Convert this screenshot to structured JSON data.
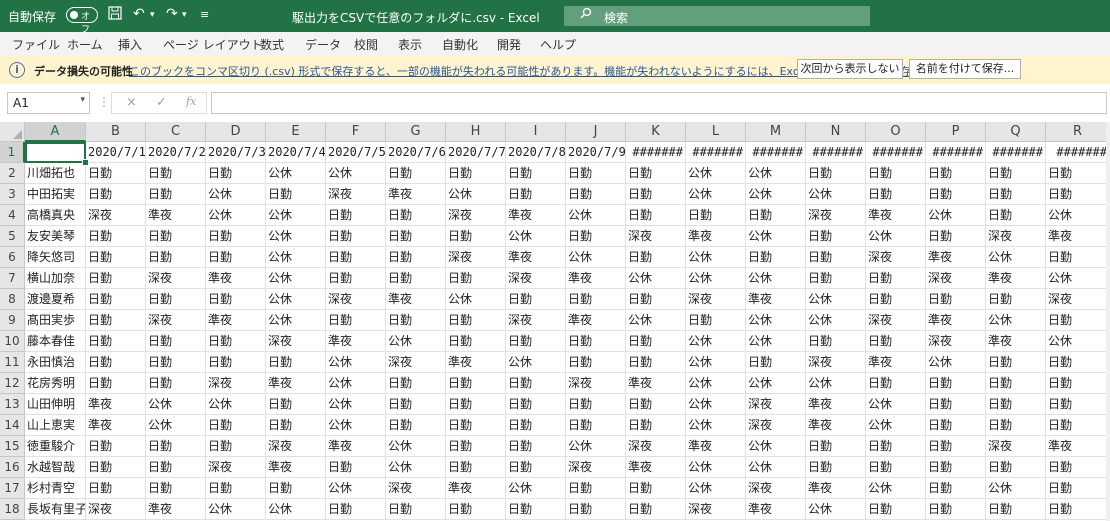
{
  "title_bar": {
    "autosave_label": "自動保存",
    "autosave_state": "オフ",
    "save_icon": "save-icon",
    "undo_icon": "undo-icon",
    "redo_icon": "redo-icon",
    "qat_icon": "customize-icon",
    "doc_title": "駆出力をCSVで任意のフォルダに.csv  -  Excel",
    "search_placeholder": "検索"
  },
  "menu": [
    "ファイル",
    "ホーム",
    "挿入",
    "ページ レイアウト",
    "数式",
    "データ",
    "校閲",
    "表示",
    "自動化",
    "開発",
    "ヘルプ"
  ],
  "infobar": {
    "title": "データ損失の可能性",
    "message": "このブックをコンマ区切り (.csv) 形式で保存すると、一部の機能が失われる可能性があります。機能が失われないようにするには、Excel ファイル形式で保存してください。",
    "btn_dismiss": "次回から表示しない",
    "btn_saveas": "名前を付けて保存..."
  },
  "formula_bar": {
    "name_box": "A1",
    "fx": "fx",
    "cancel": "×",
    "enter": "✓",
    "dots": "⋮",
    "dropdown": "▾",
    "value": ""
  },
  "columns": [
    "A",
    "B",
    "C",
    "D",
    "E",
    "F",
    "G",
    "H",
    "I",
    "J",
    "K",
    "L",
    "M",
    "N",
    "O",
    "P",
    "Q",
    "R"
  ],
  "row_numbers": [
    "1",
    "2",
    "3",
    "4",
    "5",
    "6",
    "7",
    "8",
    "9",
    "10",
    "11",
    "12",
    "13",
    "14",
    "15",
    "16",
    "17",
    "18"
  ],
  "rows": [
    [
      "",
      "2020/7/1",
      "2020/7/2",
      "2020/7/3",
      "2020/7/4",
      "2020/7/5",
      "2020/7/6",
      "2020/7/7",
      "2020/7/8",
      "2020/7/9",
      "#######",
      "#######",
      "#######",
      "#######",
      "#######",
      "#######",
      "#######",
      "#######"
    ],
    [
      "川畑拓也",
      "日勤",
      "日勤",
      "日勤",
      "公休",
      "公休",
      "日勤",
      "日勤",
      "日勤",
      "日勤",
      "日勤",
      "公休",
      "公休",
      "日勤",
      "日勤",
      "日勤",
      "日勤",
      "日勤"
    ],
    [
      "中田拓実",
      "日勤",
      "日勤",
      "公休",
      "日勤",
      "深夜",
      "準夜",
      "公休",
      "日勤",
      "日勤",
      "日勤",
      "公休",
      "公休",
      "公休",
      "日勤",
      "日勤",
      "日勤",
      "日勤"
    ],
    [
      "高橋真央",
      "深夜",
      "準夜",
      "公休",
      "公休",
      "日勤",
      "日勤",
      "深夜",
      "準夜",
      "公休",
      "日勤",
      "日勤",
      "日勤",
      "深夜",
      "準夜",
      "公休",
      "日勤",
      "公休"
    ],
    [
      "友安美琴",
      "日勤",
      "日勤",
      "日勤",
      "公休",
      "日勤",
      "日勤",
      "日勤",
      "公休",
      "日勤",
      "深夜",
      "準夜",
      "公休",
      "日勤",
      "公休",
      "日勤",
      "深夜",
      "準夜"
    ],
    [
      "降矢悠司",
      "日勤",
      "日勤",
      "日勤",
      "公休",
      "日勤",
      "日勤",
      "深夜",
      "準夜",
      "公休",
      "日勤",
      "公休",
      "日勤",
      "日勤",
      "深夜",
      "準夜",
      "公休",
      "日勤"
    ],
    [
      "横山加奈",
      "日勤",
      "深夜",
      "準夜",
      "公休",
      "日勤",
      "日勤",
      "日勤",
      "深夜",
      "準夜",
      "公休",
      "公休",
      "公休",
      "日勤",
      "日勤",
      "深夜",
      "準夜",
      "公休"
    ],
    [
      "渡邊夏希",
      "日勤",
      "日勤",
      "日勤",
      "公休",
      "深夜",
      "準夜",
      "公休",
      "日勤",
      "日勤",
      "日勤",
      "深夜",
      "準夜",
      "公休",
      "日勤",
      "日勤",
      "日勤",
      "深夜"
    ],
    [
      "髙田実歩",
      "日勤",
      "深夜",
      "準夜",
      "公休",
      "日勤",
      "日勤",
      "日勤",
      "深夜",
      "準夜",
      "公休",
      "日勤",
      "公休",
      "公休",
      "深夜",
      "準夜",
      "公休",
      "日勤"
    ],
    [
      "藤本春佳",
      "日勤",
      "日勤",
      "日勤",
      "深夜",
      "準夜",
      "公休",
      "日勤",
      "日勤",
      "日勤",
      "日勤",
      "公休",
      "公休",
      "日勤",
      "日勤",
      "深夜",
      "準夜",
      "公休"
    ],
    [
      "永田慎治",
      "日勤",
      "日勤",
      "日勤",
      "日勤",
      "公休",
      "深夜",
      "準夜",
      "公休",
      "日勤",
      "日勤",
      "公休",
      "日勤",
      "深夜",
      "準夜",
      "公休",
      "日勤",
      "日勤"
    ],
    [
      "花房秀明",
      "日勤",
      "日勤",
      "深夜",
      "準夜",
      "公休",
      "日勤",
      "日勤",
      "日勤",
      "深夜",
      "準夜",
      "公休",
      "公休",
      "公休",
      "日勤",
      "日勤",
      "日勤",
      "日勤"
    ],
    [
      "山田伸明",
      "準夜",
      "公休",
      "公休",
      "日勤",
      "公休",
      "日勤",
      "日勤",
      "日勤",
      "日勤",
      "日勤",
      "公休",
      "深夜",
      "準夜",
      "公休",
      "日勤",
      "日勤",
      "日勤"
    ],
    [
      "山上恵実",
      "準夜",
      "公休",
      "日勤",
      "日勤",
      "公休",
      "日勤",
      "日勤",
      "日勤",
      "日勤",
      "日勤",
      "公休",
      "深夜",
      "準夜",
      "公休",
      "日勤",
      "日勤",
      "日勤"
    ],
    [
      "徳重駿介",
      "日勤",
      "日勤",
      "日勤",
      "深夜",
      "準夜",
      "公休",
      "日勤",
      "日勤",
      "公休",
      "深夜",
      "準夜",
      "公休",
      "日勤",
      "日勤",
      "日勤",
      "深夜",
      "準夜"
    ],
    [
      "水越智哉",
      "日勤",
      "日勤",
      "深夜",
      "準夜",
      "日勤",
      "公休",
      "日勤",
      "日勤",
      "深夜",
      "準夜",
      "公休",
      "公休",
      "日勤",
      "日勤",
      "日勤",
      "日勤",
      "日勤"
    ],
    [
      "杉村青空",
      "日勤",
      "日勤",
      "日勤",
      "日勤",
      "公休",
      "深夜",
      "準夜",
      "公休",
      "日勤",
      "日勤",
      "公休",
      "深夜",
      "準夜",
      "公休",
      "日勤",
      "公休",
      "日勤"
    ],
    [
      "長坂有里子",
      "深夜",
      "準夜",
      "公休",
      "公休",
      "日勤",
      "日勤",
      "日勤",
      "日勤",
      "日勤",
      "日勤",
      "深夜",
      "準夜",
      "公休",
      "日勤",
      "日勤",
      "日勤",
      "日勤"
    ]
  ],
  "colors": {
    "excel_green": "#217346",
    "infobar_bg": "#fff4ce"
  }
}
